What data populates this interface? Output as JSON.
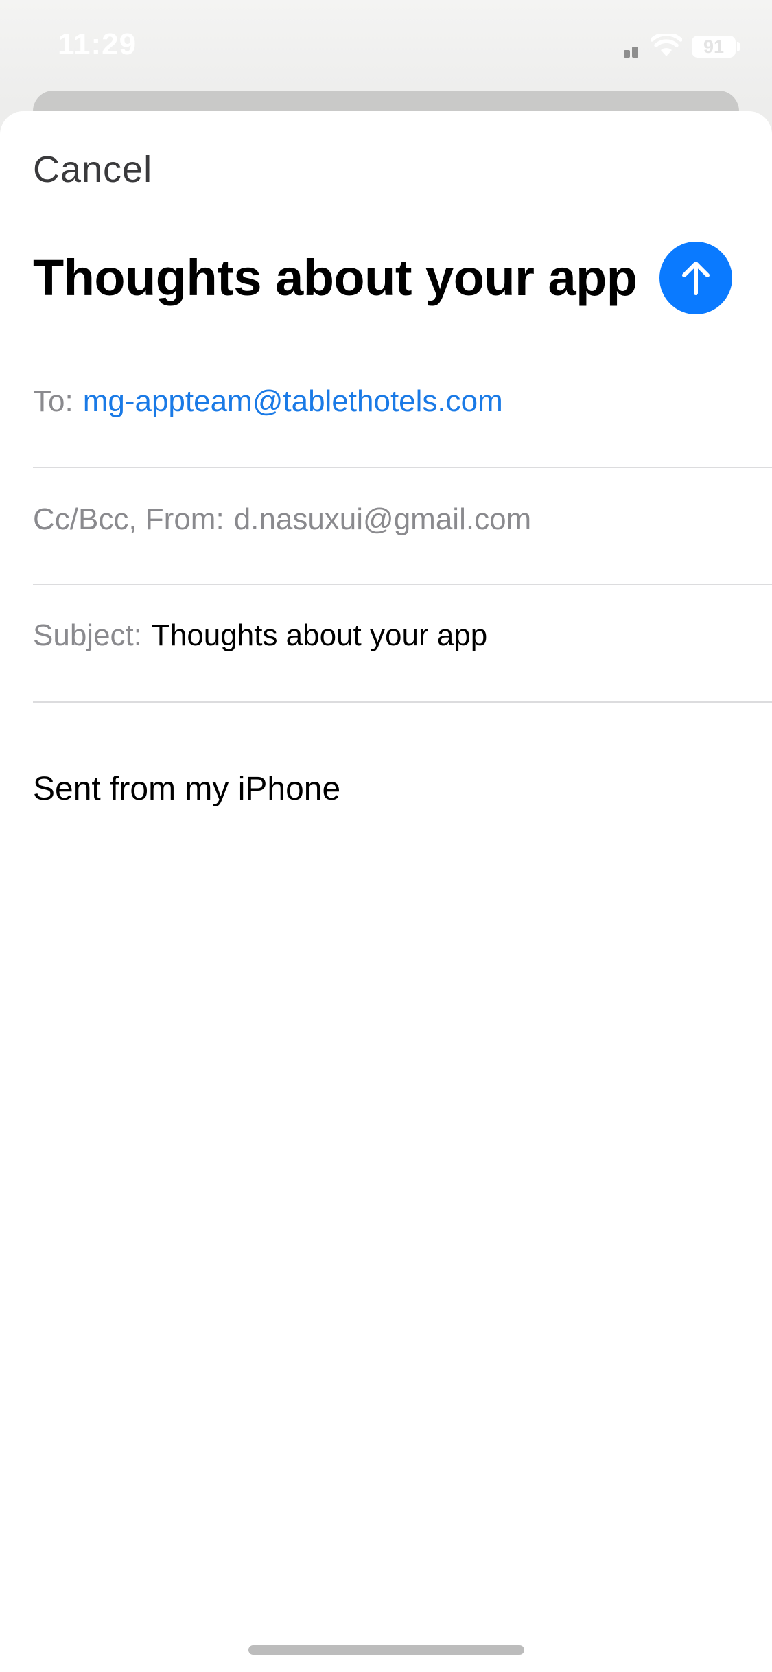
{
  "status_bar": {
    "time": "11:29",
    "battery": "91"
  },
  "compose": {
    "cancel_label": "Cancel",
    "title": "Thoughts about your app",
    "to_label": "To:",
    "to_value": "mg-appteam@tablethotels.com",
    "cc_label": "Cc/Bcc, From:",
    "cc_value": "d.nasuxui@gmail.com",
    "subject_label": "Subject:",
    "subject_value": "Thoughts about your app",
    "body": "Sent from my iPhone"
  },
  "icons": {
    "send": "arrow-up-icon",
    "wifi": "wifi-icon",
    "signal": "cellular-signal-icon",
    "battery": "battery-icon"
  },
  "colors": {
    "accent": "#0a7aff",
    "recipient": "#1a7ae6",
    "label": "#8a8a8e"
  }
}
